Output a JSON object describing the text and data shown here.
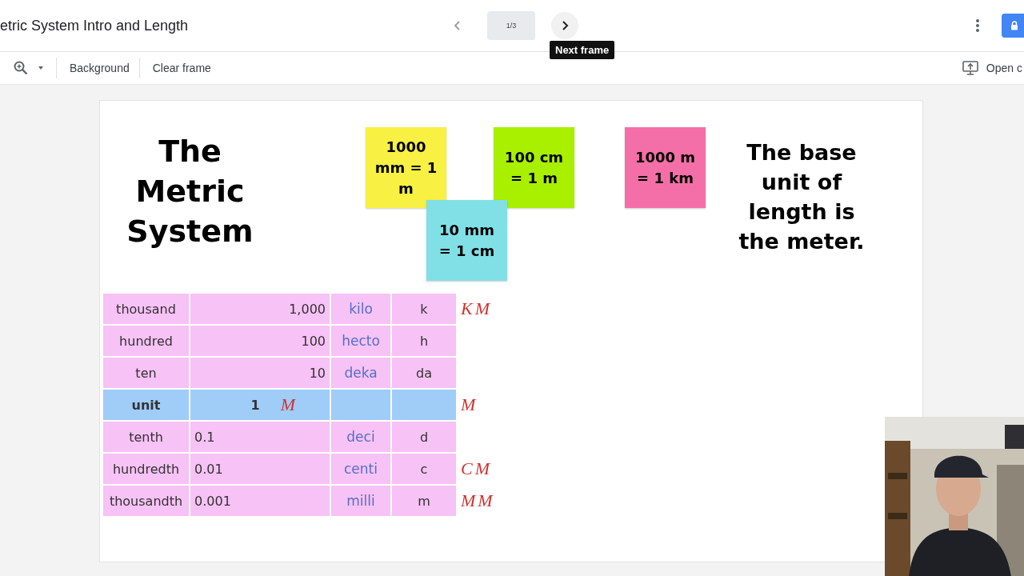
{
  "document": {
    "title": "etric System Intro and Length"
  },
  "frame_nav": {
    "counter": "1/3",
    "tooltip": "Next frame"
  },
  "toolbar": {
    "buttons": [
      "Background",
      "Clear frame"
    ],
    "present": "Open c"
  },
  "frame": {
    "title": "The Metric System",
    "notes": [
      {
        "text": "1000 mm = 1 m",
        "color": "#f8f043"
      },
      {
        "text": "100 cm = 1 m",
        "color": "#a8f000"
      },
      {
        "text": "1000 m = 1 km",
        "color": "#f46fa8"
      },
      {
        "text": "10 mm = 1 cm",
        "color": "#80e0e6"
      }
    ],
    "caption": "The base unit of length is the meter.",
    "table": {
      "rows": [
        {
          "kind": "multiple",
          "name": "thousand",
          "value": "1,000",
          "prefix": "kilo",
          "symbol": "k",
          "margin_note": "KM"
        },
        {
          "kind": "multiple",
          "name": "hundred",
          "value": "100",
          "prefix": "hecto",
          "symbol": "h"
        },
        {
          "kind": "multiple",
          "name": "ten",
          "value": "10",
          "prefix": "deka",
          "symbol": "da"
        },
        {
          "kind": "unit",
          "name": "unit",
          "value": "1",
          "note": "M",
          "margin_note": "M"
        },
        {
          "kind": "fraction",
          "name": "tenth",
          "value": "0.1",
          "prefix": "deci",
          "symbol": "d"
        },
        {
          "kind": "fraction",
          "name": "hundredth",
          "value": "0.01",
          "prefix": "centi",
          "symbol": "c",
          "margin_note": "CM"
        },
        {
          "kind": "fraction",
          "name": "thousandth",
          "value": "0.001",
          "prefix": "milli",
          "symbol": "m",
          "margin_note": "MM"
        }
      ]
    }
  }
}
